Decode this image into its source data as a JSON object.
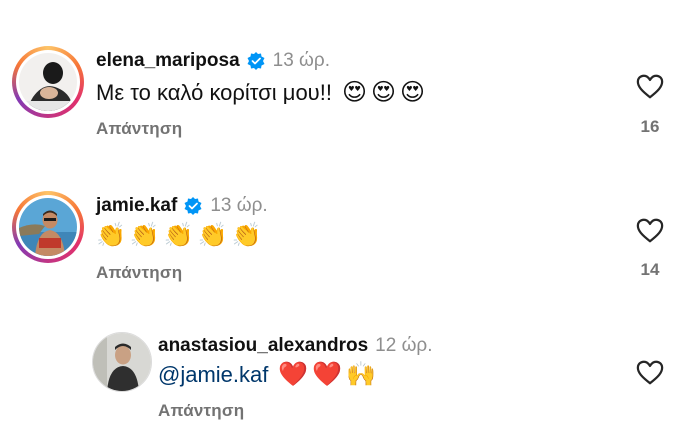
{
  "colors": {
    "text": "#111111",
    "meta": "#8e8e8e",
    "action": "#737373",
    "verified": "#0095f6",
    "mention": "#00376b"
  },
  "comments": [
    {
      "username": "elena_mariposa",
      "verified": true,
      "time": "13 ώρ.",
      "text": "Με το καλό κορίτσι μου!!",
      "emojis": [
        "😍",
        "😍",
        "😍"
      ],
      "reply_label": "Απάντηση",
      "likes": "16",
      "avatar_icon": "avatar"
    },
    {
      "username": "jamie.kaf",
      "verified": true,
      "time": "13 ώρ.",
      "text": "",
      "emojis": [
        "👏",
        "👏",
        "👏",
        "👏",
        "👏"
      ],
      "reply_label": "Απάντηση",
      "likes": "14",
      "avatar_icon": "avatar"
    },
    {
      "username": "anastasiou_alexandros",
      "verified": false,
      "time": "12 ώρ.",
      "mention": "@jamie.kaf",
      "emojis": [
        "❤️",
        "❤️",
        "🙌"
      ],
      "reply_label": "Απάντηση",
      "likes": "",
      "avatar_icon": "avatar"
    }
  ]
}
